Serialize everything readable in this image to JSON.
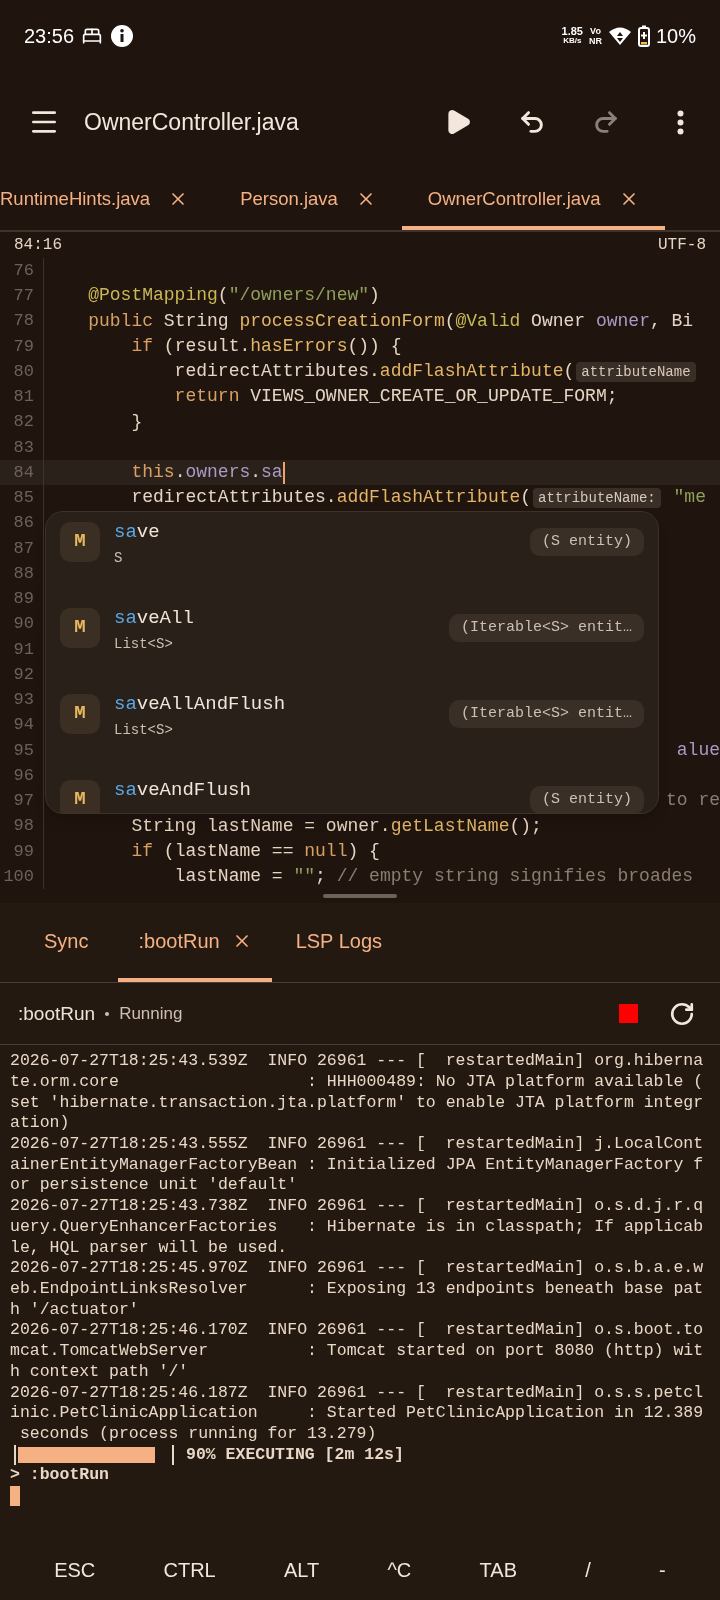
{
  "status_bar": {
    "time": "23:56",
    "speed": "1.85",
    "speed_unit": "KB/s",
    "network_top": "Vo",
    "network_bottom": "NR",
    "battery": "10%"
  },
  "toolbar": {
    "title": "OwnerController.java",
    "actions": [
      {
        "kind": "run",
        "disabled": false
      },
      {
        "kind": "undo",
        "disabled": false
      },
      {
        "kind": "redo",
        "disabled": true
      },
      {
        "kind": "more",
        "disabled": false
      }
    ]
  },
  "file_tabs": [
    {
      "label": "RuntimeHints.java",
      "selected": false
    },
    {
      "label": "Person.java",
      "selected": false
    },
    {
      "label": "OwnerController.java",
      "selected": true
    }
  ],
  "editor": {
    "position": "84:16",
    "encoding": "UTF-8",
    "lines": [
      {
        "number": "76",
        "current": false
      },
      {
        "number": "77",
        "current": false,
        "segments": [
          {
            "kind": "annotation",
            "text": "    @PostMapping"
          },
          {
            "kind": "plain",
            "text": "("
          },
          {
            "kind": "string",
            "text": "\"/owners/new\""
          },
          {
            "kind": "plain",
            "text": ")"
          }
        ]
      },
      {
        "number": "78",
        "current": false,
        "segments": [
          {
            "kind": "keyword",
            "text": "    public"
          },
          {
            "kind": "plain",
            "text": " String "
          },
          {
            "kind": "method",
            "text": "processCreationForm"
          },
          {
            "kind": "plain",
            "text": "("
          },
          {
            "kind": "annotation",
            "text": "@Valid"
          },
          {
            "kind": "plain",
            "text": " Owner "
          },
          {
            "kind": "field",
            "text": "owner"
          },
          {
            "kind": "plain",
            "text": ", Bi"
          }
        ]
      },
      {
        "number": "79",
        "current": false,
        "segments": [
          {
            "kind": "keyword",
            "text": "        if"
          },
          {
            "kind": "plain",
            "text": " (result."
          },
          {
            "kind": "method",
            "text": "hasErrors"
          },
          {
            "kind": "plain",
            "text": "()) {"
          }
        ]
      },
      {
        "number": "80",
        "current": false,
        "segments": [
          {
            "kind": "plain",
            "text": "            redirectAttributes."
          },
          {
            "kind": "method",
            "text": "addFlashAttribute"
          },
          {
            "kind": "plain",
            "text": "("
          },
          {
            "kind": "hint",
            "text": "attributeName"
          }
        ]
      },
      {
        "number": "81",
        "current": false,
        "segments": [
          {
            "kind": "keyword",
            "text": "            return"
          },
          {
            "kind": "plain",
            "text": " VIEWS_OWNER_CREATE_OR_UPDATE_FORM;"
          }
        ]
      },
      {
        "number": "82",
        "current": false,
        "segments": [
          {
            "kind": "plain",
            "text": "        }"
          }
        ]
      },
      {
        "number": "83",
        "current": false
      },
      {
        "number": "84",
        "current": true,
        "segments": [
          {
            "kind": "keyword",
            "text": "        this"
          },
          {
            "kind": "plain",
            "text": "."
          },
          {
            "kind": "field",
            "text": "owners"
          },
          {
            "kind": "plain",
            "text": "."
          },
          {
            "kind": "field",
            "text": "sa"
          }
        ]
      },
      {
        "number": "85",
        "current": false,
        "segments": [
          {
            "kind": "plain",
            "text": "        redirectAttributes."
          },
          {
            "kind": "method",
            "text": "addFlashAttribute"
          },
          {
            "kind": "plain",
            "text": "("
          },
          {
            "kind": "hint",
            "text": "attributeName:"
          },
          {
            "kind": "string",
            "text": " \"me"
          }
        ]
      },
      {
        "number": "86",
        "current": false
      },
      {
        "number": "87",
        "current": false
      },
      {
        "number": "88",
        "current": false
      },
      {
        "number": "89",
        "current": false
      },
      {
        "number": "90",
        "current": false
      },
      {
        "number": "91",
        "current": false
      },
      {
        "number": "92",
        "current": false
      },
      {
        "number": "93",
        "current": false
      },
      {
        "number": "94",
        "current": false
      },
      {
        "number": "95",
        "current": false,
        "tail": {
          "kind": "field",
          "text": "alue"
        }
      },
      {
        "number": "96",
        "current": false
      },
      {
        "number": "97",
        "current": false,
        "tail": {
          "kind": "comment",
          "text": "to re"
        }
      },
      {
        "number": "98",
        "current": false,
        "segments": [
          {
            "kind": "plain",
            "text": "        String lastName = owner."
          },
          {
            "kind": "method",
            "text": "getLastName"
          },
          {
            "kind": "plain",
            "text": "();"
          }
        ]
      },
      {
        "number": "99",
        "current": false,
        "segments": [
          {
            "kind": "keyword",
            "text": "        if"
          },
          {
            "kind": "plain",
            "text": " (lastName == "
          },
          {
            "kind": "keyword",
            "text": "null"
          },
          {
            "kind": "plain",
            "text": ") {"
          }
        ]
      },
      {
        "number": "100",
        "current": false,
        "segments": [
          {
            "kind": "plain",
            "text": "            lastName = "
          },
          {
            "kind": "string",
            "text": "\"\""
          },
          {
            "kind": "plain",
            "text": "; "
          },
          {
            "kind": "comment",
            "text": "// empty string signifies broades"
          }
        ]
      }
    ],
    "completions": [
      {
        "badge": "M",
        "match": "sa",
        "rest": "ve",
        "type": "S",
        "signature": "(S entity)"
      },
      {
        "badge": "M",
        "match": "sa",
        "rest": "veAll",
        "type": "List<S>",
        "signature": "(Iterable<S> entit…"
      },
      {
        "badge": "M",
        "match": "sa",
        "rest": "veAllAndFlush",
        "type": "List<S>",
        "signature": "(Iterable<S> entit…"
      },
      {
        "badge": "M",
        "match": "sa",
        "rest": "veAndFlush",
        "signature": "(S entity)"
      }
    ]
  },
  "panel_tabs": [
    {
      "label": "Sync",
      "selected": false,
      "closable": false
    },
    {
      "label": ":bootRun",
      "selected": true,
      "closable": true
    },
    {
      "label": "LSP Logs",
      "selected": false,
      "closable": false
    }
  ],
  "run": {
    "task": ":bootRun",
    "status": "Running"
  },
  "terminal": {
    "rows": [
      "2026-07-27T18:25:43.539Z  INFO 26961 --- [  restartedMain] org.hiberna",
      "te.orm.core                   : HHH000489: No JTA platform available (",
      "set 'hibernate.transaction.jta.platform' to enable JTA platform integr",
      "ation)",
      "2026-07-27T18:25:43.555Z  INFO 26961 --- [  restartedMain] j.LocalCont",
      "ainerEntityManagerFactoryBean : Initialized JPA EntityManagerFactory f",
      "or persistence unit 'default'",
      "2026-07-27T18:25:43.738Z  INFO 26961 --- [  restartedMain] o.s.d.j.r.q",
      "uery.QueryEnhancerFactories   : Hibernate is in classpath; If applicab",
      "le, HQL parser will be used.",
      "2026-07-27T18:25:45.970Z  INFO 26961 --- [  restartedMain] o.s.b.a.e.w",
      "eb.EndpointLinksResolver      : Exposing 13 endpoints beneath base pat",
      "h '/actuator'",
      "2026-07-27T18:25:46.170Z  INFO 26961 --- [  restartedMain] o.s.boot.to",
      "mcat.TomcatWebServer          : Tomcat started on port 8080 (http) wit",
      "h context path '/'",
      "2026-07-27T18:25:46.187Z  INFO 26961 --- [  restartedMain] o.s.s.petcl",
      "inic.PetClinicApplication     : Started PetClinicApplication in 12.389",
      " seconds (process running for 13.279)"
    ],
    "progress": {
      "level": 0.9,
      "label": "90% EXECUTING [2m 12s]"
    },
    "prompt": "> :bootRun"
  },
  "extra_keys": [
    "ESC",
    "CTRL",
    "ALT",
    "^C",
    "TAB",
    "/",
    "-"
  ]
}
